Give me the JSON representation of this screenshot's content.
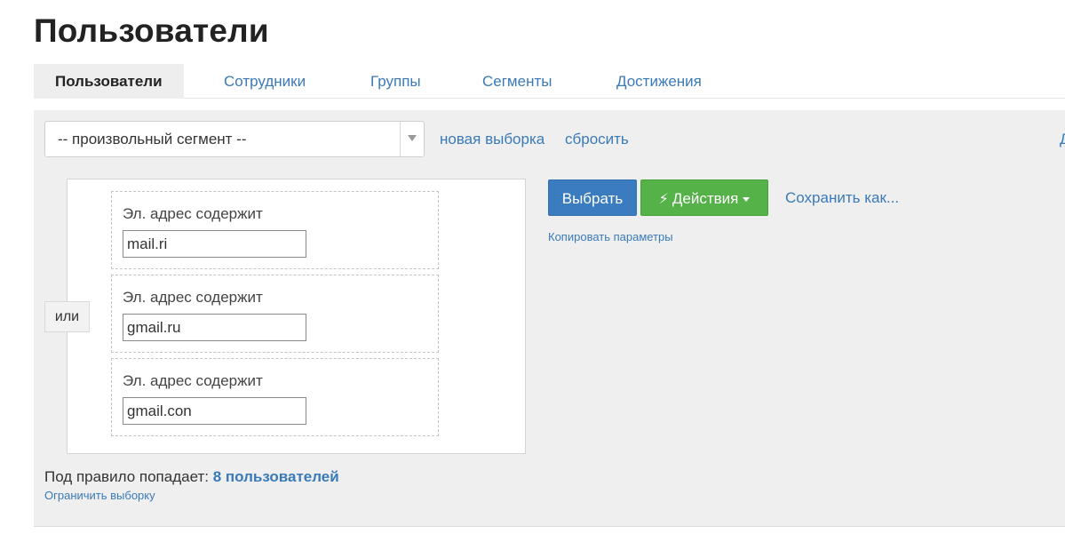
{
  "page": {
    "title": "Пользователи"
  },
  "tabs": [
    {
      "label": "Пользователи",
      "active": true
    },
    {
      "label": "Сотрудники",
      "active": false
    },
    {
      "label": "Группы",
      "active": false
    },
    {
      "label": "Сегменты",
      "active": false
    },
    {
      "label": "Достижения",
      "active": false
    }
  ],
  "segment_select": {
    "value": "-- произвольный сегмент --"
  },
  "toolbar": {
    "new_selection": "новая выборка",
    "reset": "сбросить",
    "edge_link": "Д"
  },
  "rules": {
    "or_label": "или",
    "items": [
      {
        "label": "Эл. адрес содержит",
        "value": "mail.ri"
      },
      {
        "label": "Эл. адрес содержит",
        "value": "gmail.ru"
      },
      {
        "label": "Эл. адрес содержит",
        "value": "gmail.con"
      }
    ]
  },
  "actions": {
    "select_label": "Выбрать",
    "actions_label": "Действия",
    "save_as_label": "Сохранить как...",
    "copy_params": "Копировать параметры"
  },
  "result": {
    "prefix": "Под правило попадает:",
    "count_text": "8 пользователей",
    "limit_link": "Ограничить выборку"
  },
  "colors": {
    "link": "#3a7ab8",
    "primary_button": "#3b7bbf",
    "success_button": "#55b248",
    "panel_bg": "#efefef"
  }
}
